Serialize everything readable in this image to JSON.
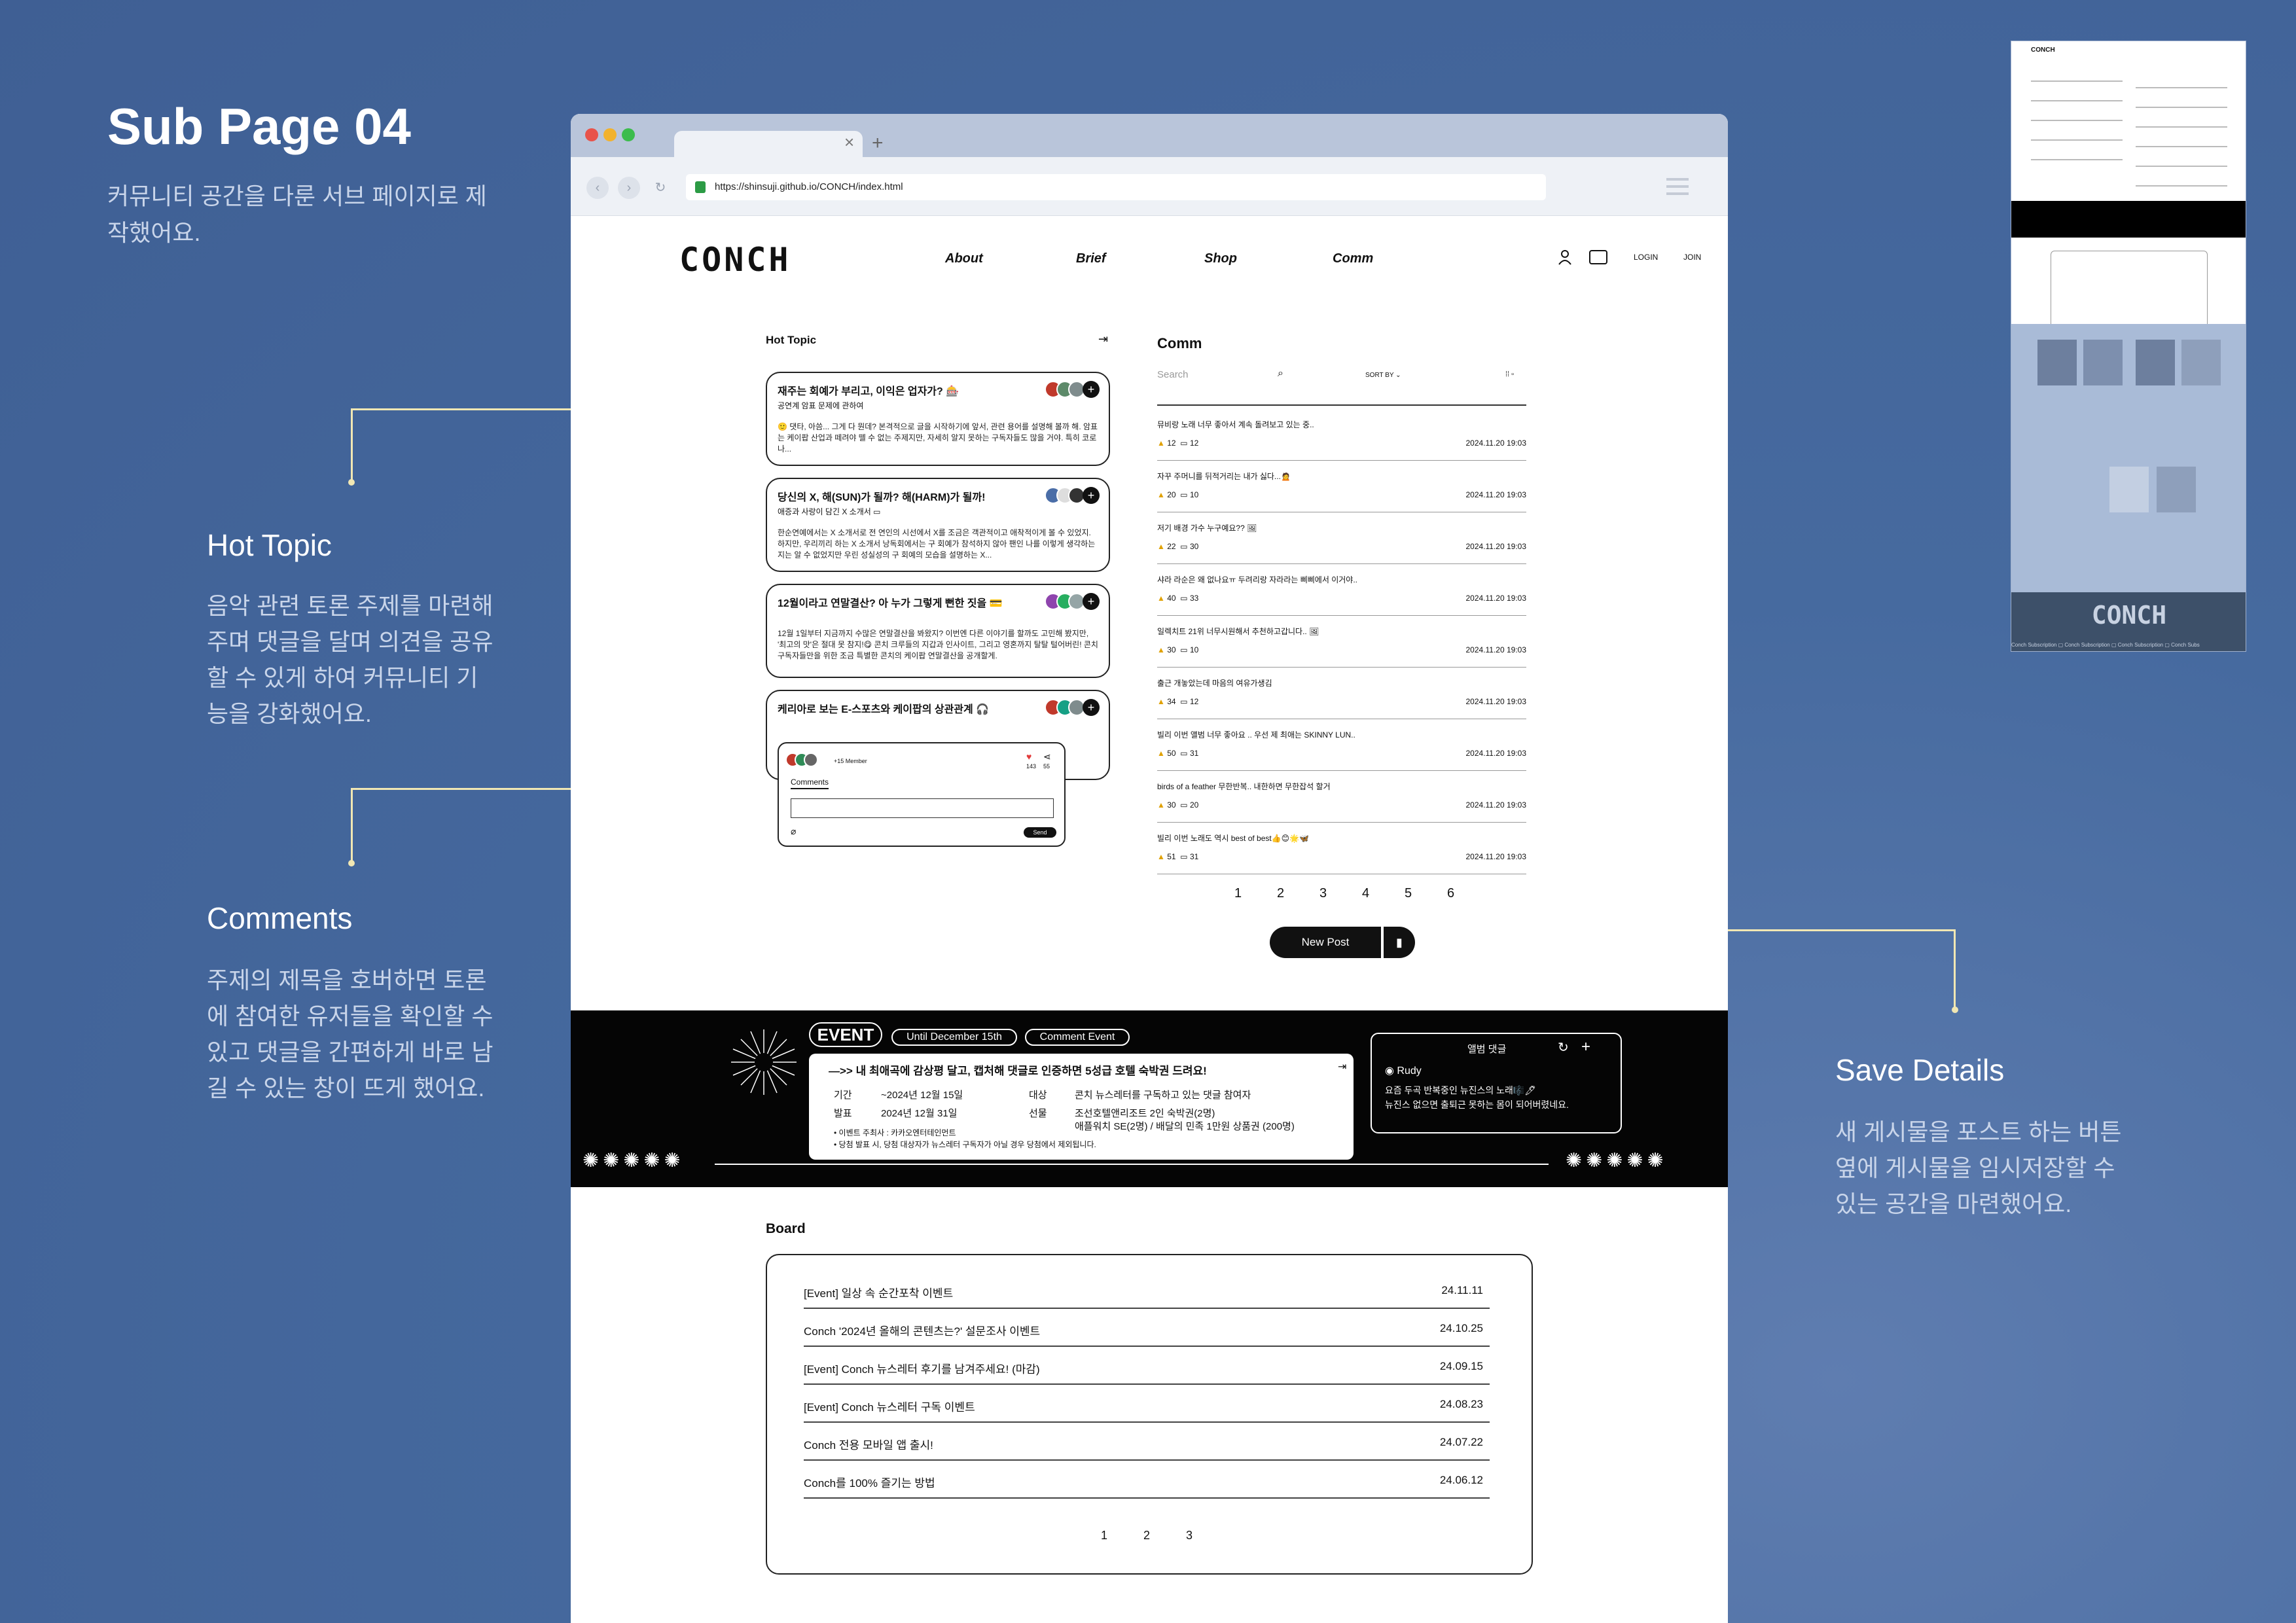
{
  "intro": {
    "title": "Sub Page 04",
    "desc": "커뮤니티 공간을 다룬 서브 페이지로 제작했어요."
  },
  "annotations": [
    {
      "title": "Hot Topic",
      "desc": "음악 관련 토론 주제를 마련해주며 댓글을 달며 의견을 공유할 수 있게 하여 커뮤니티 기능을 강화했어요."
    },
    {
      "title": "Comments",
      "desc": "주제의 제목을 호버하면 토론에 참여한 유저들을 확인할 수 있고 댓글을 간편하게 바로 남길 수 있는 창이 뜨게 했어요."
    },
    {
      "title": "Save Details",
      "desc": "새 게시물을 포스트 하는 버튼 옆에 게시물을 임시저장할 수 있는 공간을 마련했어요."
    }
  ],
  "browser": {
    "url": "https://shinsuji.github.io/CONCH/index.html",
    "tab_close": "×",
    "tab_new": "+"
  },
  "header": {
    "logo": "CONCH",
    "nav": [
      "About",
      "Brief",
      "Shop",
      "Comm"
    ],
    "login": "LOGIN",
    "join": "JOIN"
  },
  "hot_topic": {
    "heading": "Hot Topic",
    "cards": [
      {
        "title": "재주는 회예가 부리고, 이익은 업자가? 🎰",
        "sub": "공연계 암표 문제에 관하여",
        "body": "🙂 댓타, 아씀... 그게 다 뭔데? 본격적으로 글을 시작하기에 앞서, 관련 용어를 설명해 볼까 해. 암표는 케이팝 산업과 떼려야 뗄 수 없는 주제지만, 자세히 알지 못하는 구독자들도 많을 거야. 특히 코로나..."
      },
      {
        "title": "당신의 X, 해(SUN)가 될까? 해(HARM)가 될까!",
        "sub": "애증과 사랑이 담긴 X 소개서 ▭",
        "body": "한순연예에서는 X 소개서로 전 연인의 시선에서 X를 조금은 객관적이고 애착적이게 볼 수 있었지. 하지만, 우리끼리 하는 X 소개서 낭독회에서는 구 회예가 참석하지 않아 팬인 나를 이렇게 생각하는지는 알 수 없었지만 우린 성실성의 구 회예의 모습을 설명하는 X..."
      },
      {
        "title": "12월이라고 연말결산? 아 누가 그렇게 뻔한 짓을 💳",
        "sub": "",
        "body": "12월 1일부터 지금까지 수많은 연말결산을 봐왔지? 이번엔 다른 이야기를 할까도 고민해 봤지만, '최고의 맛'은 절대 못 참지!😋 콘치 크루들의 지갑과 인사이트, 그리고 영혼까지 탈탈 털어버린! 콘치 구독자들만을 위한 조금 특별한 콘치의 케이팝 연말결산을 공개할게."
      },
      {
        "title": "케리아로 보는 E-스포츠와 케이팝의 상관관계 🎧",
        "sub": "",
        "body": ""
      }
    ],
    "popup": {
      "member_count": "+15 Member",
      "likes": "143",
      "shares": "55",
      "tab": "Comments",
      "send": "Send"
    }
  },
  "comm": {
    "heading": "Comm",
    "search_placeholder": "Search",
    "sort": "SORT BY",
    "rows": [
      {
        "title": "뮤비랑 노래 너무 좋아서 계속 돌려보고 있는 중..",
        "likes": "12",
        "comments": "12",
        "date": "2024.11.20 19:03"
      },
      {
        "title": "자꾸 주머니를 뒤적거리는 내가 싫다...🙍",
        "likes": "20",
        "comments": "10",
        "date": "2024.11.20 19:03"
      },
      {
        "title": "저기 배경 가수 누구예요?? 🖼",
        "likes": "22",
        "comments": "30",
        "date": "2024.11.20 19:03"
      },
      {
        "title": "샤라 라순은 왜 없나요ㅠ 두려리랑 자라라는 삐삐에서 이거야..",
        "likes": "40",
        "comments": "33",
        "date": "2024.11.20 19:03"
      },
      {
        "title": "일렉치트 21위 너무시원해서 추천하고갑니다.. 🖼",
        "likes": "30",
        "comments": "10",
        "date": "2024.11.20 19:03"
      },
      {
        "title": "출근 개놓았는데 마음의 여유가생김",
        "likes": "34",
        "comments": "12",
        "date": "2024.11.20 19:03"
      },
      {
        "title": "빌리 이번 앨범 너무 좋아요 .. 우선 제 최애는 SKINNY LUN..",
        "likes": "50",
        "comments": "31",
        "date": "2024.11.20 19:03"
      },
      {
        "title": "birds of a feather 무한반복.. 내한하면 무한잡석 할거",
        "likes": "30",
        "comments": "20",
        "date": "2024.11.20 19:03"
      },
      {
        "title": "빌리 이번 노래도 역시 best of best👍😊🌟🦋",
        "likes": "51",
        "comments": "31",
        "date": "2024.11.20 19:03"
      }
    ],
    "pages": [
      "1",
      "2",
      "3",
      "4",
      "5",
      "6"
    ],
    "new_post": "New Post"
  },
  "event": {
    "badge": "EVENT",
    "until": "Until December 15th",
    "type": "Comment Event",
    "headline": "—>> 내 최애곡에 감상평 달고, 캡처해 댓글로 인증하면 5성급 호텔 숙박권 드려요!",
    "period_label": "기간",
    "period": "~2024년 12월 15일",
    "announce_label": "발표",
    "announce": "2024년 12월 31일",
    "target_label": "대상",
    "target": "콘치 뉴스레터를 구독하고 있는 댓글 참여자",
    "gift_label": "선물",
    "gift1": "조선호텔앤리조트 2인 숙박권(2명)",
    "gift2": "애플워치 SE(2명) / 배달의 민족 1만원 상품권 (200명)",
    "note1": "이벤트 주최사 : 카카오엔터테인먼트",
    "note2": "당첨 발표 시, 당첨 대상자가 뉴스레터 구독자가 아닐 경우 당첨에서 제외됩니다.",
    "side_title": "앨범 댓글",
    "side_user": "Rudy",
    "side_text1": "요즘 두곡 반복중인 뉴진스의 노래🎼🖊",
    "side_text2": "뉴진스 없으면 출퇴근 못하는 몸이 되어버렸네요."
  },
  "board": {
    "heading": "Board",
    "rows": [
      {
        "title": "[Event] 일상 속 순간포착 이벤트",
        "date": "24.11.11"
      },
      {
        "title": "Conch '2024년 올해의 콘텐츠는?' 설문조사 이벤트",
        "date": "24.10.25"
      },
      {
        "title": "[Event] Conch 뉴스레터 후기를 남겨주세요! (마감)",
        "date": "24.09.15"
      },
      {
        "title": "[Event] Conch 뉴스레터 구독 이벤트",
        "date": "24.08.23"
      },
      {
        "title": "Conch 전용 모바일 앱 출시!",
        "date": "24.07.22"
      },
      {
        "title": "Conch를 100% 즐기는 방법",
        "date": "24.06.12"
      }
    ],
    "pages": [
      "1",
      "2",
      "3"
    ]
  },
  "thumbnail": {
    "logo": "CONCH",
    "footer": "Conch Subscription ▢ Conch Subscription ▢ Conch Subscription ▢ Conch Subs"
  },
  "colors": {
    "bg": "#3f5f94",
    "accent_line": "#f1e7b3",
    "event_bg": "#050505"
  }
}
